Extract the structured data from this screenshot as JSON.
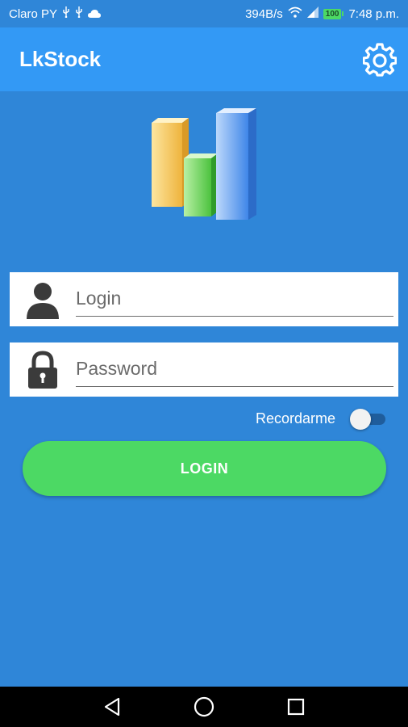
{
  "status_bar": {
    "carrier": "Claro PY",
    "speed": "394B/s",
    "battery": "100",
    "time": "7:48 p.m.",
    "icons": [
      "usb-icon",
      "usb-icon",
      "cloud-icon",
      "wifi-icon",
      "signal-icon",
      "battery-icon"
    ]
  },
  "app_bar": {
    "title": "LkStock",
    "settings_icon": "gear-icon"
  },
  "logo": {
    "icon": "bar-chart-logo",
    "colors": [
      "#f6c343",
      "#5ed14f",
      "#4a8ef0"
    ]
  },
  "form": {
    "login": {
      "placeholder": "Login",
      "value": "",
      "icon": "user-icon"
    },
    "password": {
      "placeholder": "Password",
      "value": "",
      "icon": "lock-icon"
    },
    "remember": {
      "label": "Recordarme",
      "checked": false
    },
    "submit_label": "LOGIN"
  },
  "nav_bar": {
    "buttons": [
      "back-icon",
      "home-icon",
      "recents-icon"
    ]
  },
  "colors": {
    "background": "#2f86d8",
    "app_bar": "#3399f5",
    "button": "#4cd964"
  }
}
